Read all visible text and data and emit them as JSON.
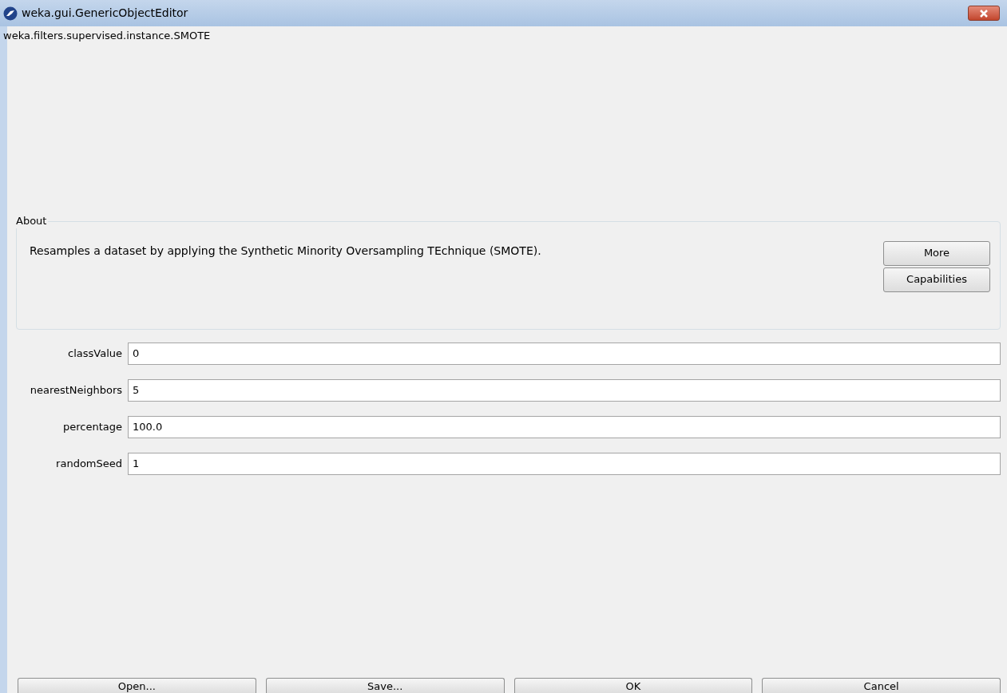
{
  "window": {
    "title": "weka.gui.GenericObjectEditor"
  },
  "class_name": "weka.filters.supervised.instance.SMOTE",
  "about": {
    "legend": "About",
    "text": "Resamples a dataset by applying the Synthetic Minority Oversampling TEchnique (SMOTE).",
    "buttons": [
      "More",
      "Capabilities"
    ]
  },
  "properties": [
    {
      "label": "classValue",
      "value": "0"
    },
    {
      "label": "nearestNeighbors",
      "value": "5"
    },
    {
      "label": "percentage",
      "value": "100.0"
    },
    {
      "label": "randomSeed",
      "value": "1"
    }
  ],
  "buttons": [
    "Open...",
    "Save...",
    "OK",
    "Cancel"
  ]
}
